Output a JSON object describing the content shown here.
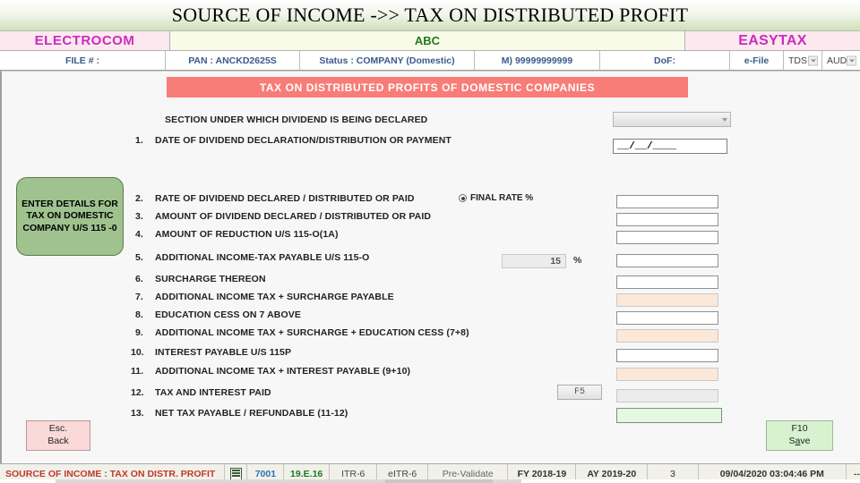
{
  "window": {
    "title": "SOURCE OF INCOME ->> TAX ON DISTRIBUTED PROFIT"
  },
  "brand": {
    "left": "ELECTROCOM",
    "middle": "ABC",
    "right": "EASYTAX"
  },
  "info_bar": {
    "file": "FILE # :",
    "pan": "PAN : ANCKD2625S",
    "status": "Status : COMPANY (Domestic)",
    "mobile": "M) 99999999999",
    "dof": "DoF:",
    "efile": "e-File",
    "tds": "TDS",
    "audit": "AUDIT"
  },
  "form": {
    "banner": "TAX ON DISTRIBUTED PROFITS OF DOMESTIC COMPANIES",
    "section_label": "SECTION UNDER WHICH DIVIDEND IS BEING DECLARED",
    "section_value": "",
    "date_label": "DATE OF DIVIDEND DECLARATION/DISTRIBUTION OR PAYMENT",
    "date_num": "1.",
    "date_value": "__/__/____",
    "final_rate_label": "FINAL RATE %",
    "rate_value": "15",
    "rate_percent_symbol": "%",
    "f5_label": "F5",
    "rows": [
      {
        "num": "2.",
        "label": "RATE OF DIVIDEND DECLARED / DISTRIBUTED OR PAID",
        "value": ""
      },
      {
        "num": "3.",
        "label": "AMOUNT OF DIVIDEND DECLARED / DISTRIBUTED OR PAID",
        "value": ""
      },
      {
        "num": "4.",
        "label": "AMOUNT OF REDUCTION U/S 115-O(1A)",
        "value": ""
      },
      {
        "num": "5.",
        "label": "ADDITIONAL INCOME-TAX PAYABLE U/S 115-O",
        "value": ""
      },
      {
        "num": "6.",
        "label": "SURCHARGE THEREON",
        "value": ""
      },
      {
        "num": "7.",
        "label": "ADDITIONAL INCOME TAX + SURCHARGE PAYABLE",
        "value": ""
      },
      {
        "num": "8.",
        "label": "EDUCATION CESS ON 7 ABOVE",
        "value": ""
      },
      {
        "num": "9.",
        "label": "ADDITIONAL INCOME TAX + SURCHARGE + EDUCATION CESS (7+8)",
        "value": ""
      },
      {
        "num": "10.",
        "label": "INTEREST PAYABLE U/S 115P",
        "value": ""
      },
      {
        "num": "11.",
        "label": "ADDITIONAL INCOME TAX + INTEREST PAYABLE (9+10)",
        "value": ""
      },
      {
        "num": "12.",
        "label": "TAX AND INTEREST PAID",
        "value": ""
      },
      {
        "num": "13.",
        "label": "NET TAX PAYABLE / REFUNDABLE (11-12)",
        "value": ""
      }
    ]
  },
  "callout": {
    "text": "ENTER DETAILS FOR TAX ON DOMESTIC COMPANY U/S 115 -0"
  },
  "buttons": {
    "esc_key": "Esc.",
    "esc_label": "Back",
    "save_key": "F10",
    "save_label_a": "S",
    "save_label_b": "a",
    "save_label_c": "ve"
  },
  "status_bar": {
    "title": "SOURCE OF INCOME : TAX ON DISTR. PROFIT",
    "code": "7001",
    "version": "19.E.16",
    "itr": "ITR-6",
    "eitr": "eITR-6",
    "prevalidate": "Pre-Validate",
    "fy": "FY 2018-19",
    "ay": "AY 2019-20",
    "count": "3",
    "datetime": "09/04/2020 03:04:46 PM",
    "trailing": "--"
  },
  "colors": {
    "banner": "#f87c77",
    "callout": "#9fc28f",
    "brand_text": "#cc2bbf",
    "calc_field": "#fbe8d9",
    "net_field": "#e6f7e3"
  }
}
